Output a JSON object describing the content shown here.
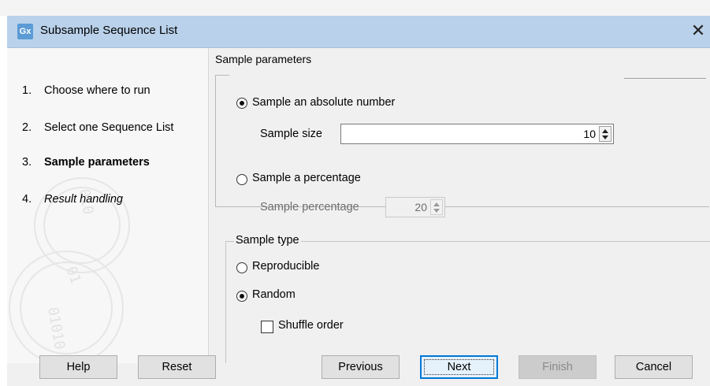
{
  "window": {
    "icon_text": "Gx",
    "title": "Subsample Sequence List",
    "close_glyph": "✕"
  },
  "steps": [
    {
      "num": "1.",
      "label": "Choose where to run",
      "style": "normal"
    },
    {
      "num": "2.",
      "label": "Select one Sequence List",
      "style": "normal"
    },
    {
      "num": "3.",
      "label": "Sample parameters",
      "style": "bold"
    },
    {
      "num": "4.",
      "label": "Result handling",
      "style": "italic"
    }
  ],
  "sample_parameters": {
    "title": "Sample parameters",
    "absolute": {
      "label": "Sample an absolute number",
      "selected": true
    },
    "sample_size": {
      "label": "Sample size",
      "value": "10"
    },
    "percentage": {
      "label": "Sample a percentage",
      "selected": false
    },
    "sample_percentage": {
      "label": "Sample percentage",
      "value": "20",
      "enabled": false
    }
  },
  "sample_type": {
    "title": "Sample type",
    "reproducible": {
      "label": "Reproducible",
      "selected": false
    },
    "random": {
      "label": "Random",
      "selected": true
    },
    "shuffle": {
      "label": "Shuffle order",
      "checked": false
    }
  },
  "buttons": {
    "help": "Help",
    "reset": "Reset",
    "previous": "Previous",
    "next": "Next",
    "finish": "Finish",
    "cancel": "Cancel"
  },
  "colors": {
    "titlebar": "#b9d1ea",
    "accent": "#0078d7",
    "icon": "#5b9bd5"
  }
}
